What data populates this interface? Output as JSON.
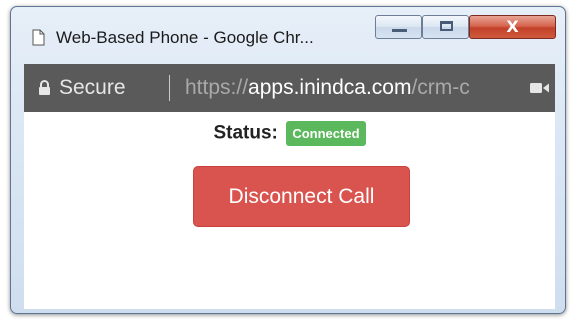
{
  "window": {
    "title": "Web-Based Phone - Google Chr...",
    "controls": {
      "minimize_icon": "minimize-icon",
      "maximize_icon": "maximize-icon",
      "close_label": "X"
    }
  },
  "addressbar": {
    "secure_label": "Secure",
    "url_scheme": "https://",
    "url_host": "apps.inindca.com",
    "url_path": "/crm-c",
    "lock_icon": "lock-icon",
    "camera_icon": "camera-icon"
  },
  "content": {
    "status_label": "Status:",
    "status_value": "Connected",
    "status_color": "#5cb85c",
    "disconnect_button": "Disconnect Call",
    "disconnect_color": "#d9534f"
  }
}
